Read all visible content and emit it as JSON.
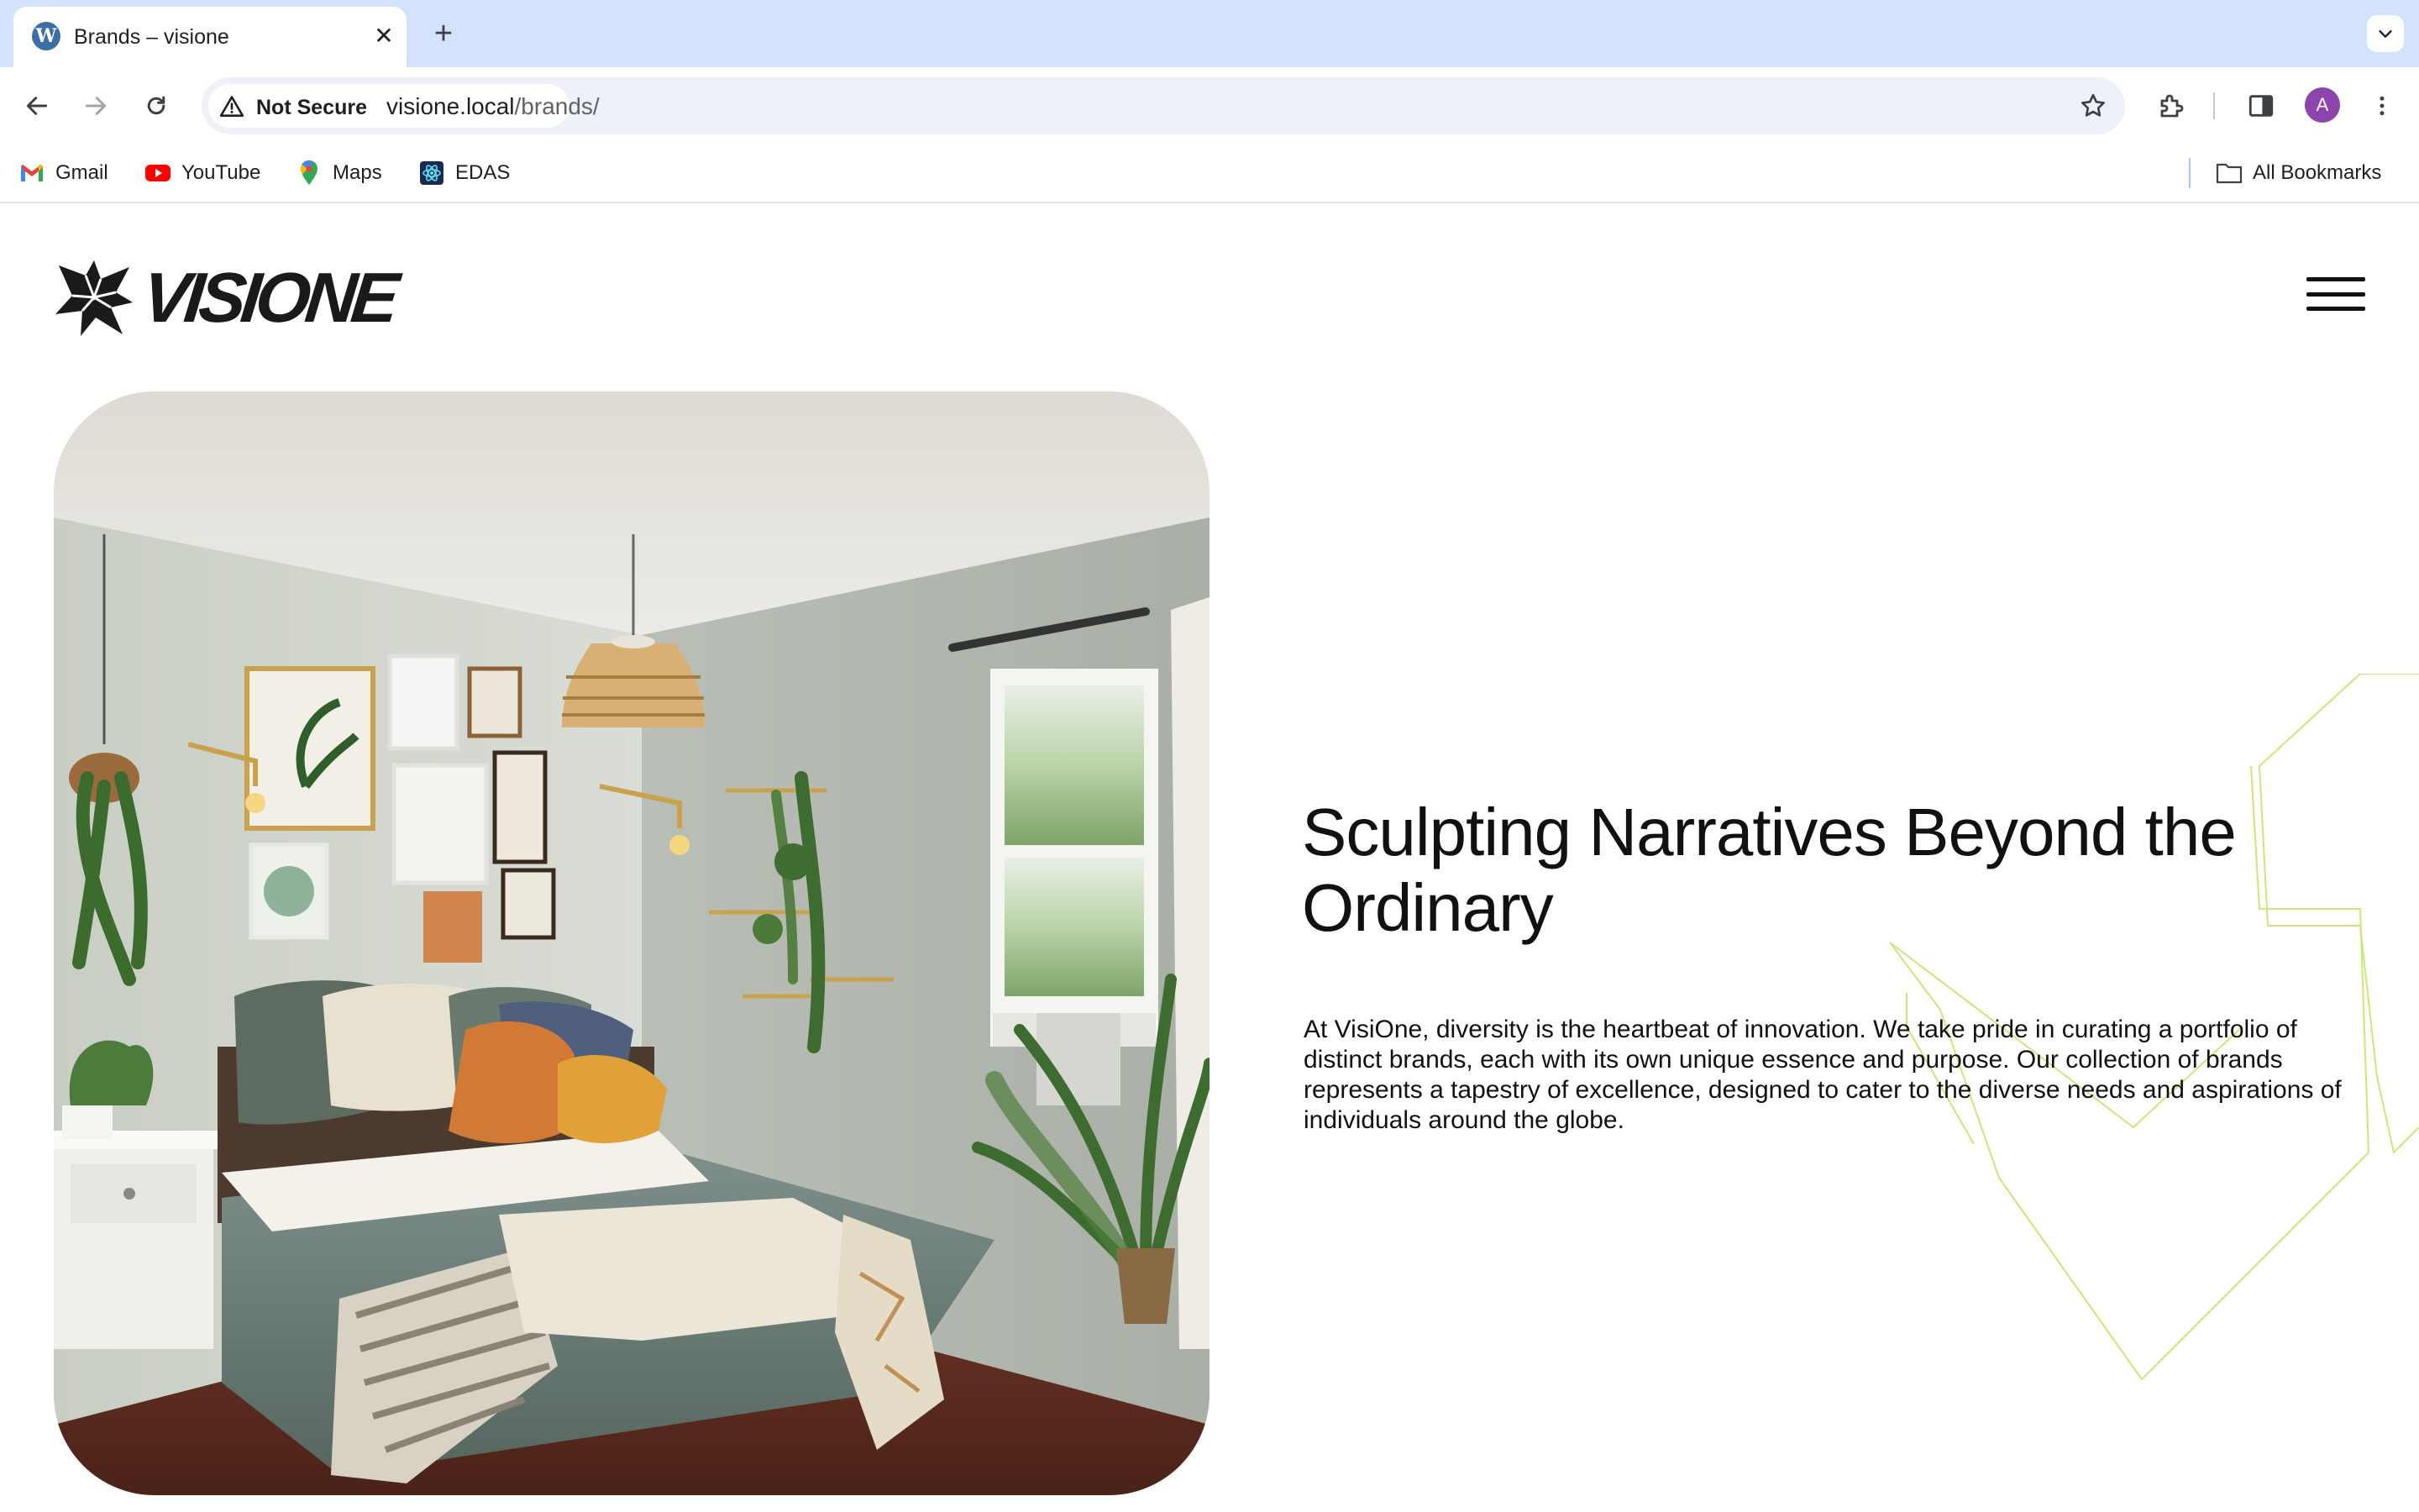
{
  "browser": {
    "tab": {
      "title": "Brands – visione",
      "favicon": "wordpress-icon"
    },
    "toolbar": {
      "security_label": "Not Secure",
      "url_host": "visione.local",
      "url_path": "/brands/",
      "profile_initial": "A"
    },
    "bookmarks": [
      {
        "label": "Gmail",
        "icon": "gmail-icon"
      },
      {
        "label": "YouTube",
        "icon": "youtube-icon"
      },
      {
        "label": "Maps",
        "icon": "maps-icon"
      },
      {
        "label": "EDAS",
        "icon": "edas-icon"
      }
    ],
    "all_bookmarks_label": "All Bookmarks"
  },
  "site": {
    "logo_text": "VISIONE",
    "hero": {
      "headline": "Sculpting Narratives Beyond the Ordinary",
      "body": "At VisiOne, diversity is the heartbeat of innovation. We take pride in curating a portfolio of distinct brands, each with its own unique essence and purpose. Our collection of brands represents a tapestry of excellence, designed to cater to the diverse needs and aspirations of individuals around the globe."
    }
  },
  "colors": {
    "tabstrip": "#d3e3fd",
    "accent_line": "#c8e87a",
    "text": "#111111"
  }
}
